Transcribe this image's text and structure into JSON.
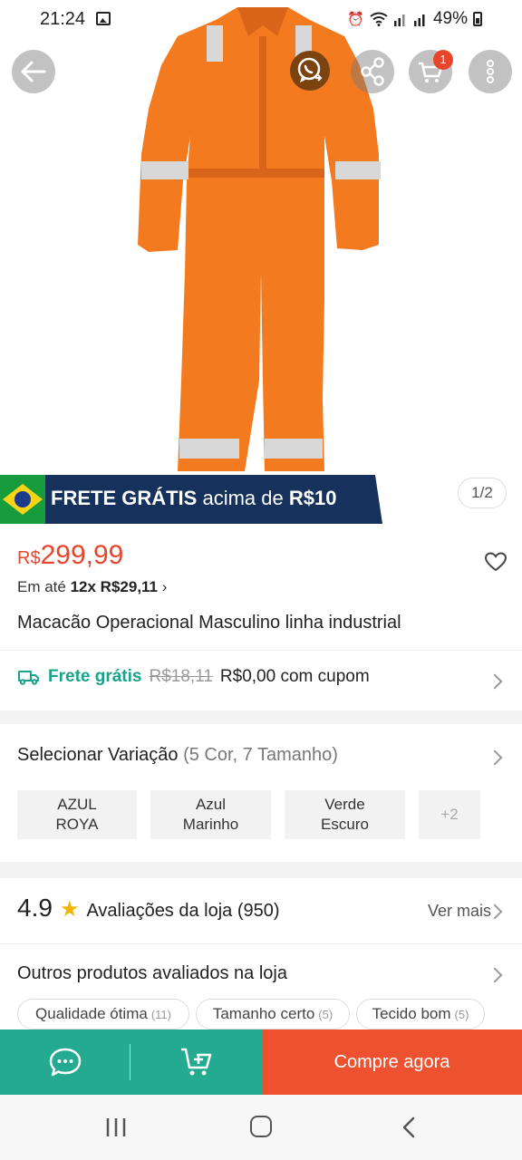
{
  "status_bar": {
    "time": "21:24",
    "battery": "49%"
  },
  "header": {
    "cart_badge": "1"
  },
  "hero": {
    "promo": {
      "bold": "FRETE GRÁTIS",
      "middle": " acima de ",
      "amount": "R$10"
    },
    "pager": "1/2"
  },
  "product": {
    "currency": "R$",
    "price": "299,99",
    "installments_prefix": "Em até ",
    "installments_value": "12x R$29,11",
    "installments_arrow": "›",
    "title": "Macacão Operacional Masculino  linha industrial"
  },
  "shipping": {
    "free_label": "Frete grátis",
    "old_price": "R$18,11",
    "new_price": "R$0,00 com cupom"
  },
  "variation": {
    "label": "Selecionar Variação",
    "summary": " (5 Cor, 7 Tamanho)",
    "options": [
      {
        "line1": "AZUL",
        "line2": "ROYA"
      },
      {
        "line1": "Azul",
        "line2": "Marinho"
      },
      {
        "line1": "Verde",
        "line2": "Escuro"
      }
    ],
    "more": "+2"
  },
  "ratings": {
    "score": "4.9",
    "star": "★",
    "label": "Avaliações da loja",
    "count": "(950)",
    "see_more": "Ver mais"
  },
  "store_reviews": {
    "label": "Outros produtos avaliados na loja",
    "tags": [
      {
        "label": "Qualidade ótima",
        "count": "(11)"
      },
      {
        "label": "Tamanho certo",
        "count": "(5)"
      },
      {
        "label": "Tecido bom",
        "count": "(5)"
      }
    ]
  },
  "bottom_bar": {
    "buy_label": "Compre agora"
  },
  "colors": {
    "accent": "#e8452c",
    "teal": "#25aa92",
    "buy": "#ee5130",
    "promo_bg": "#16325c"
  }
}
